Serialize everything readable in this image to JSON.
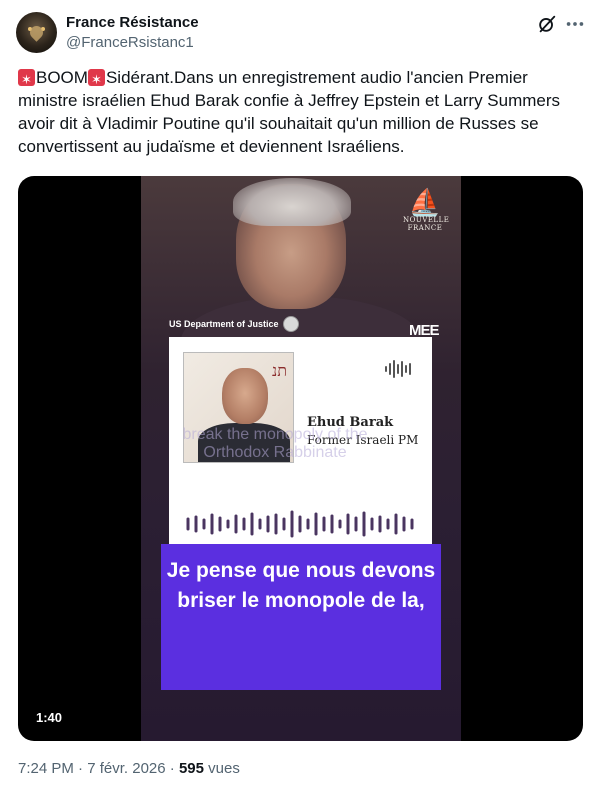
{
  "author": {
    "display_name": "France Résistance",
    "handle": "@FranceRsistanc1"
  },
  "tweet": {
    "emoji_1": "rotating-light-icon",
    "word_1": "BOOM",
    "emoji_2": "rotating-light-icon",
    "body": "Sidérant.Dans un enregistrement audio l'ancien Premier ministre israélien Ehud Barak confie à Jeffrey Epstein et Larry Summers avoir dit à Vladimir Poutine qu'il souhaitait qu'un million de Russes se convertissent au judaïsme et deviennent Israéliens."
  },
  "video": {
    "logo_line_1": "NOUVELLE",
    "logo_line_2": "FRANCE",
    "doj_label": "US Department of Justice",
    "mee_logo": "MEE",
    "card_name": "Ehud Barak",
    "card_role": "Former Israeli PM",
    "faint_subtitle": "break the monopoly of the Orthodox Rabbinate",
    "caption": "Je pense que nous devons briser le monopole de la,",
    "duration": "1:40"
  },
  "meta": {
    "time": "7:24 PM",
    "sep1": "·",
    "date": "7 févr. 2026",
    "sep2": "·",
    "views_count": "595",
    "views_label": "vues"
  },
  "colors": {
    "caption_bg": "#5b2fe0",
    "siren": "#e0384a",
    "meta_text": "#536471"
  }
}
